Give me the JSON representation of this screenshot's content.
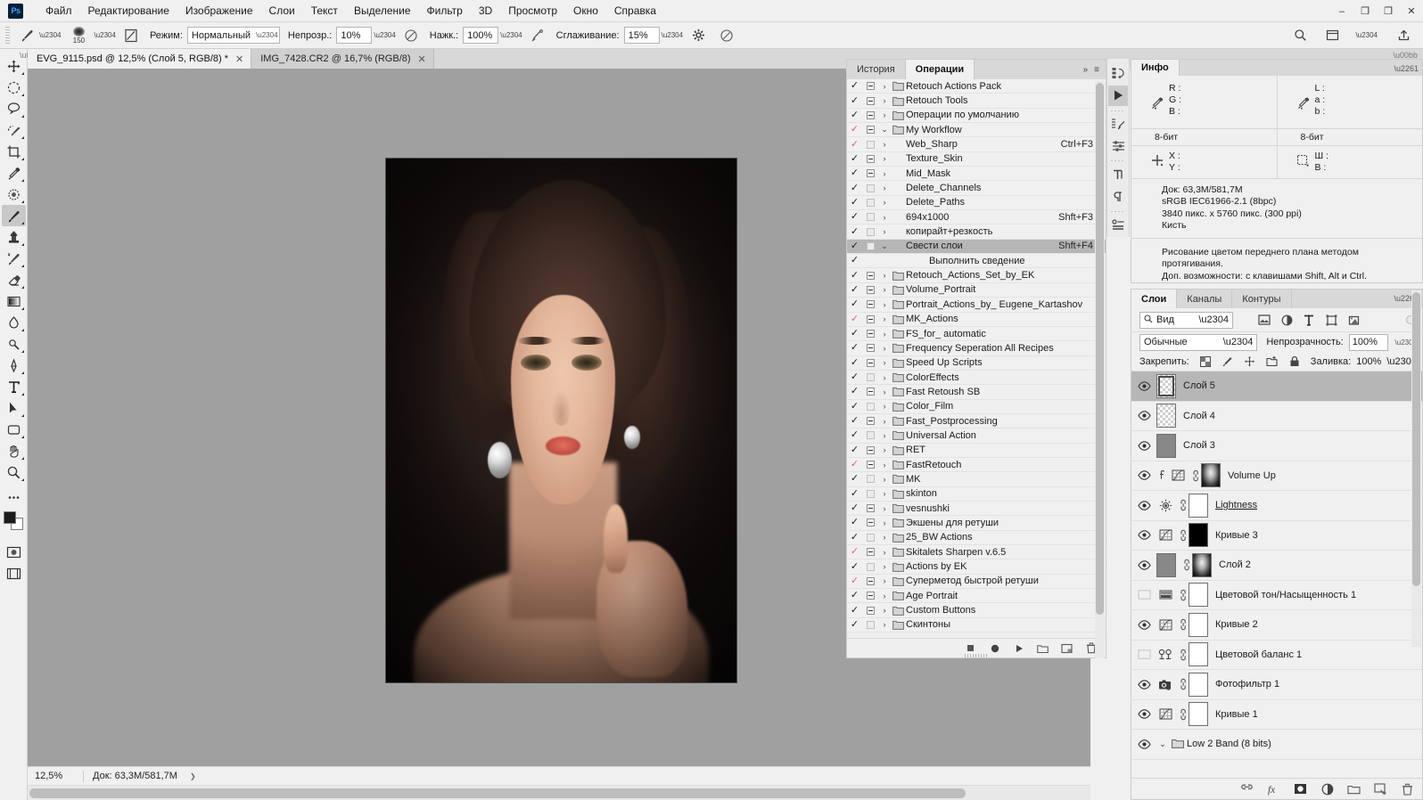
{
  "app": {
    "logo_text": "Ps",
    "menu": [
      "Файл",
      "Редактирование",
      "Изображение",
      "Слои",
      "Текст",
      "Выделение",
      "Фильтр",
      "3D",
      "Просмотр",
      "Окно",
      "Справка"
    ],
    "window_buttons": {
      "minimize": "–",
      "maximize": "❐",
      "restore": "❒",
      "close": "✕"
    }
  },
  "options_bar": {
    "brush_size": "150",
    "mode_label": "Режим:",
    "mode_value": "Нормальный",
    "opacity_label": "Непрозр.:",
    "opacity_value": "10%",
    "flow_label": "Нажк.:",
    "flow_value": "100%",
    "smoothing_label": "Сглаживание:",
    "smoothing_value": "15%"
  },
  "tabs": [
    {
      "label": "EVG_9115.psd @ 12,5% (Слой 5, RGB/8) *",
      "close": "✕",
      "active": true
    },
    {
      "label": "IMG_7428.CR2 @ 16,7% (RGB/8)",
      "close": "✕",
      "active": false
    }
  ],
  "status_bar": {
    "zoom": "12,5%",
    "doc_info": "Док: 63,3М/581,7М",
    "arrow": "❯"
  },
  "actions_panel": {
    "tabs": [
      {
        "label": "История",
        "active": false
      },
      {
        "label": "Операции",
        "active": true
      }
    ],
    "collapse_icon": "»",
    "menu_icon": "≡",
    "rows": [
      {
        "check": "black",
        "box": "filled",
        "twirl": "›",
        "folder": true,
        "name": "Retouch Actions Pack",
        "key": "",
        "indent": 0,
        "selected": false
      },
      {
        "check": "black",
        "box": "filled",
        "twirl": "›",
        "folder": true,
        "name": "Retouch Tools",
        "key": "",
        "indent": 0,
        "selected": false
      },
      {
        "check": "black",
        "box": "filled",
        "twirl": "›",
        "folder": true,
        "name": "Операции по умолчанию",
        "key": "",
        "indent": 0,
        "selected": false
      },
      {
        "check": "red",
        "box": "filled",
        "twirl": "⌄",
        "folder": true,
        "name": "My Workflow",
        "key": "",
        "indent": 0,
        "selected": false
      },
      {
        "check": "red",
        "box": "empty",
        "twirl": "›",
        "folder": false,
        "name": "Web_Sharp",
        "key": "Ctrl+F3",
        "indent": 0,
        "selected": false
      },
      {
        "check": "black",
        "box": "filled",
        "twirl": "›",
        "folder": false,
        "name": "Texture_Skin",
        "key": "",
        "indent": 0,
        "selected": false
      },
      {
        "check": "black",
        "box": "filled",
        "twirl": "›",
        "folder": false,
        "name": "Mid_Mask",
        "key": "",
        "indent": 0,
        "selected": false
      },
      {
        "check": "black",
        "box": "empty",
        "twirl": "›",
        "folder": false,
        "name": "Delete_Channels",
        "key": "",
        "indent": 0,
        "selected": false
      },
      {
        "check": "black",
        "box": "empty",
        "twirl": "›",
        "folder": false,
        "name": "Delete_Paths",
        "key": "",
        "indent": 0,
        "selected": false
      },
      {
        "check": "black",
        "box": "empty",
        "twirl": "›",
        "folder": false,
        "name": "694x1000",
        "key": "Shft+F3",
        "indent": 0,
        "selected": false
      },
      {
        "check": "black",
        "box": "empty",
        "twirl": "›",
        "folder": false,
        "name": "копирайт+резкость",
        "key": "",
        "indent": 0,
        "selected": false
      },
      {
        "check": "black",
        "box": "empty",
        "twirl": "⌄",
        "folder": false,
        "name": "Свести слои",
        "key": "Shft+F4",
        "indent": 0,
        "selected": true
      },
      {
        "check": "black",
        "box": "none",
        "twirl": "",
        "folder": false,
        "name": "Выполнить сведение",
        "key": "",
        "indent": 1,
        "selected": false
      },
      {
        "check": "black",
        "box": "filled",
        "twirl": "›",
        "folder": true,
        "name": "Retouch_Actions_Set_by_EK",
        "key": "",
        "indent": 0,
        "selected": false
      },
      {
        "check": "black",
        "box": "filled",
        "twirl": "›",
        "folder": true,
        "name": "Volume_Portrait",
        "key": "",
        "indent": 0,
        "selected": false
      },
      {
        "check": "black",
        "box": "filled",
        "twirl": "›",
        "folder": true,
        "name": "Portrait_Actions_by_ Eugene_Kartashov",
        "key": "",
        "indent": 0,
        "selected": false
      },
      {
        "check": "red",
        "box": "filled",
        "twirl": "›",
        "folder": true,
        "name": "MK_Actions",
        "key": "",
        "indent": 0,
        "selected": false
      },
      {
        "check": "black",
        "box": "filled",
        "twirl": "›",
        "folder": true,
        "name": "FS_for_ automatic",
        "key": "",
        "indent": 0,
        "selected": false
      },
      {
        "check": "black",
        "box": "filled",
        "twirl": "›",
        "folder": true,
        "name": "Frequency Seperation All Recipes",
        "key": "",
        "indent": 0,
        "selected": false
      },
      {
        "check": "black",
        "box": "filled",
        "twirl": "›",
        "folder": true,
        "name": "Speed Up Scripts",
        "key": "",
        "indent": 0,
        "selected": false
      },
      {
        "check": "black",
        "box": "empty",
        "twirl": "›",
        "folder": true,
        "name": "ColorEffects",
        "key": "",
        "indent": 0,
        "selected": false
      },
      {
        "check": "black",
        "box": "filled",
        "twirl": "›",
        "folder": true,
        "name": "Fast Retoush SB",
        "key": "",
        "indent": 0,
        "selected": false
      },
      {
        "check": "black",
        "box": "empty",
        "twirl": "›",
        "folder": true,
        "name": "Color_Film",
        "key": "",
        "indent": 0,
        "selected": false
      },
      {
        "check": "black",
        "box": "filled",
        "twirl": "›",
        "folder": true,
        "name": "Fast_Postprocessing",
        "key": "",
        "indent": 0,
        "selected": false
      },
      {
        "check": "black",
        "box": "empty",
        "twirl": "›",
        "folder": true,
        "name": "Universal Action",
        "key": "",
        "indent": 0,
        "selected": false
      },
      {
        "check": "black",
        "box": "filled",
        "twirl": "›",
        "folder": true,
        "name": "RET",
        "key": "",
        "indent": 0,
        "selected": false
      },
      {
        "check": "red",
        "box": "filled",
        "twirl": "›",
        "folder": true,
        "name": "FastRetouch",
        "key": "",
        "indent": 0,
        "selected": false
      },
      {
        "check": "black",
        "box": "empty",
        "twirl": "›",
        "folder": true,
        "name": "MK",
        "key": "",
        "indent": 0,
        "selected": false
      },
      {
        "check": "black",
        "box": "empty",
        "twirl": "›",
        "folder": true,
        "name": "skinton",
        "key": "",
        "indent": 0,
        "selected": false
      },
      {
        "check": "black",
        "box": "filled",
        "twirl": "›",
        "folder": true,
        "name": "vesnushki",
        "key": "",
        "indent": 0,
        "selected": false
      },
      {
        "check": "black",
        "box": "filled",
        "twirl": "›",
        "folder": true,
        "name": "Экшены для ретуши",
        "key": "",
        "indent": 0,
        "selected": false
      },
      {
        "check": "black",
        "box": "empty",
        "twirl": "›",
        "folder": true,
        "name": "25_BW Actions",
        "key": "",
        "indent": 0,
        "selected": false
      },
      {
        "check": "red",
        "box": "filled",
        "twirl": "›",
        "folder": true,
        "name": "Skitalets Sharpen v.6.5",
        "key": "",
        "indent": 0,
        "selected": false
      },
      {
        "check": "black",
        "box": "empty",
        "twirl": "›",
        "folder": true,
        "name": "Actions by EK",
        "key": "",
        "indent": 0,
        "selected": false
      },
      {
        "check": "red",
        "box": "filled",
        "twirl": "›",
        "folder": true,
        "name": "Суперметод быстрой ретуши",
        "key": "",
        "indent": 0,
        "selected": false
      },
      {
        "check": "black",
        "box": "filled",
        "twirl": "›",
        "folder": true,
        "name": "Age Portrait",
        "key": "",
        "indent": 0,
        "selected": false
      },
      {
        "check": "black",
        "box": "filled",
        "twirl": "›",
        "folder": true,
        "name": "Custom Buttons",
        "key": "",
        "indent": 0,
        "selected": false
      },
      {
        "check": "black",
        "box": "empty",
        "twirl": "›",
        "folder": true,
        "name": "Скинтоны",
        "key": "",
        "indent": 0,
        "selected": false
      }
    ]
  },
  "info_panel": {
    "tab_label": "Инфо",
    "rgb": {
      "r": "R :",
      "g": "G :",
      "b": "B :",
      "depth": "8-бит"
    },
    "lab": {
      "l": "L :",
      "a": "a :",
      "b": "b :",
      "depth": "8-бит"
    },
    "coords": {
      "x": "X :",
      "y": "Y :"
    },
    "size": {
      "w": "Ш :",
      "h": "В :"
    },
    "doc_lines": [
      "Док: 63,3М/581,7М",
      "sRGB IEC61966-2.1 (8bpc)",
      "3840 пикс. x 5760 пикс. (300 ppi)",
      "Кисть"
    ],
    "hint_lines": [
      "Рисование цветом переднего плана методом протягивания.",
      "Доп. возможности: с клавишами Shift, Alt и Ctrl."
    ]
  },
  "layers_panel": {
    "tabs": [
      {
        "label": "Слои",
        "active": true
      },
      {
        "label": "Каналы",
        "active": false
      },
      {
        "label": "Контуры",
        "active": false
      }
    ],
    "filter_value": "Вид",
    "blend_mode": "Обычные",
    "opacity_label": "Непрозрачность:",
    "opacity_value": "100%",
    "lock_label": "Закрепить:",
    "fill_label": "Заливка:",
    "fill_value": "100%",
    "layers": [
      {
        "name": "Слой 5",
        "visible": true,
        "selected": true,
        "thumb": "checker",
        "thumb_selected": true,
        "fx": false,
        "adj": "",
        "link": false,
        "group": false
      },
      {
        "name": "Слой 4",
        "visible": true,
        "selected": false,
        "thumb": "checker",
        "thumb_selected": false,
        "fx": false,
        "adj": "",
        "link": false,
        "group": false
      },
      {
        "name": "Слой 3",
        "visible": true,
        "selected": false,
        "thumb": "gray",
        "thumb_selected": false,
        "fx": false,
        "adj": "",
        "link": false,
        "group": false
      },
      {
        "name": "Volume Up",
        "visible": true,
        "selected": false,
        "thumb": "portrait-bw",
        "thumb_selected": false,
        "fx": true,
        "adj": "curves",
        "link": true,
        "group": false
      },
      {
        "name": "Lightness",
        "visible": true,
        "selected": false,
        "thumb": "white",
        "thumb_selected": false,
        "fx": false,
        "adj": "brightness",
        "link": true,
        "group": false,
        "underline": true
      },
      {
        "name": "Кривые 3",
        "visible": true,
        "selected": false,
        "thumb": "black",
        "thumb_selected": false,
        "fx": false,
        "adj": "curves",
        "link": true,
        "group": false
      },
      {
        "name": "Слой 2",
        "visible": true,
        "selected": false,
        "thumb": "portrait-bw",
        "thumb_selected": false,
        "fx": false,
        "adj": "graythumb",
        "link": true,
        "group": false
      },
      {
        "name": "Цветовой тон/Насыщенность 1",
        "visible": false,
        "selected": false,
        "thumb": "white",
        "thumb_selected": false,
        "fx": false,
        "adj": "huesat",
        "link": true,
        "group": false
      },
      {
        "name": "Кривые 2",
        "visible": true,
        "selected": false,
        "thumb": "white",
        "thumb_selected": false,
        "fx": false,
        "adj": "curves",
        "link": true,
        "group": false
      },
      {
        "name": "Цветовой баланс 1",
        "visible": false,
        "selected": false,
        "thumb": "white",
        "thumb_selected": false,
        "fx": false,
        "adj": "balance",
        "link": true,
        "group": false
      },
      {
        "name": "Фотофильтр 1",
        "visible": true,
        "selected": false,
        "thumb": "white",
        "thumb_selected": false,
        "fx": false,
        "adj": "photofilter",
        "link": true,
        "group": false
      },
      {
        "name": "Кривые 1",
        "visible": true,
        "selected": false,
        "thumb": "white",
        "thumb_selected": false,
        "fx": false,
        "adj": "curves",
        "link": true,
        "group": false
      },
      {
        "name": "Low 2 Band (8 bits)",
        "visible": true,
        "selected": false,
        "thumb": "",
        "thumb_selected": false,
        "fx": false,
        "adj": "",
        "link": false,
        "group": true
      }
    ]
  }
}
